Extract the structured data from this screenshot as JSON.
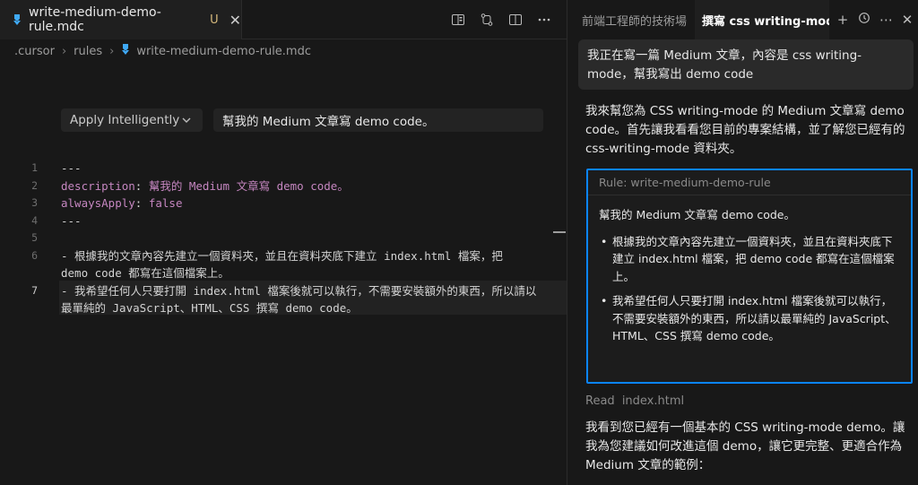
{
  "editor": {
    "tab": {
      "title": "write-medium-demo-rule.mdc",
      "status": "U"
    },
    "breadcrumb": [
      ".cursor",
      "rules",
      "write-medium-demo-rule.mdc"
    ],
    "rule": {
      "apply_mode": "Apply Intelligently",
      "description": "幫我的 Medium 文章寫 demo code。"
    },
    "lines": [
      {
        "num": "1",
        "text": "---"
      },
      {
        "num": "2",
        "key": "description",
        "value": "幫我的 Medium 文章寫 demo code。"
      },
      {
        "num": "3",
        "key": "alwaysApply",
        "value": "false"
      },
      {
        "num": "4",
        "text": "---"
      },
      {
        "num": "5",
        "text": ""
      },
      {
        "num": "6",
        "text_a": "- 根據我的文章內容先建立一個資料夾，並且在資料夾底下建立 index.html 檔案，把",
        "text_b": "demo code 都寫在這個檔案上。"
      },
      {
        "num": "7",
        "text_a": "- 我希望任何人只要打開 index.html 檔案後就可以執行，不需要安裝額外的東西，所以請以",
        "text_b": "最單純的 JavaScript、HTML、CSS 撰寫 demo code。"
      }
    ]
  },
  "panel": {
    "tabs": [
      "前端工程師的技術場",
      "撰寫 css writing-mode 的"
    ],
    "user_message": "我正在寫一篇 Medium 文章，內容是 css writing-mode，幫我寫出 demo code",
    "ai_intro": "我來幫您為 CSS writing-mode 的 Medium 文章寫 demo code。首先讓我看看您目前的專案結構，並了解您已經有的 css-writing-mode 資料夾。",
    "rule_card": {
      "header": "Rule: write-medium-demo-rule",
      "description": "幫我的 Medium 文章寫 demo code。",
      "bullets": [
        "根據我的文章內容先建立一個資料夾，並且在資料夾底下建立 index.html 檔案，把 demo code 都寫在這個檔案上。",
        "我希望任何人只要打開 index.html 檔案後就可以執行，不需要安裝額外的東西，所以請以最單純的 JavaScript、HTML、CSS 撰寫 demo code。"
      ]
    },
    "read": {
      "label": "Read",
      "file": "index.html"
    },
    "ai_followup": "我看到您已經有一個基本的 CSS writing-mode demo。讓我為您建議如何改進這個 demo，讓它更完整、更適合作為 Medium 文章的範例："
  }
}
